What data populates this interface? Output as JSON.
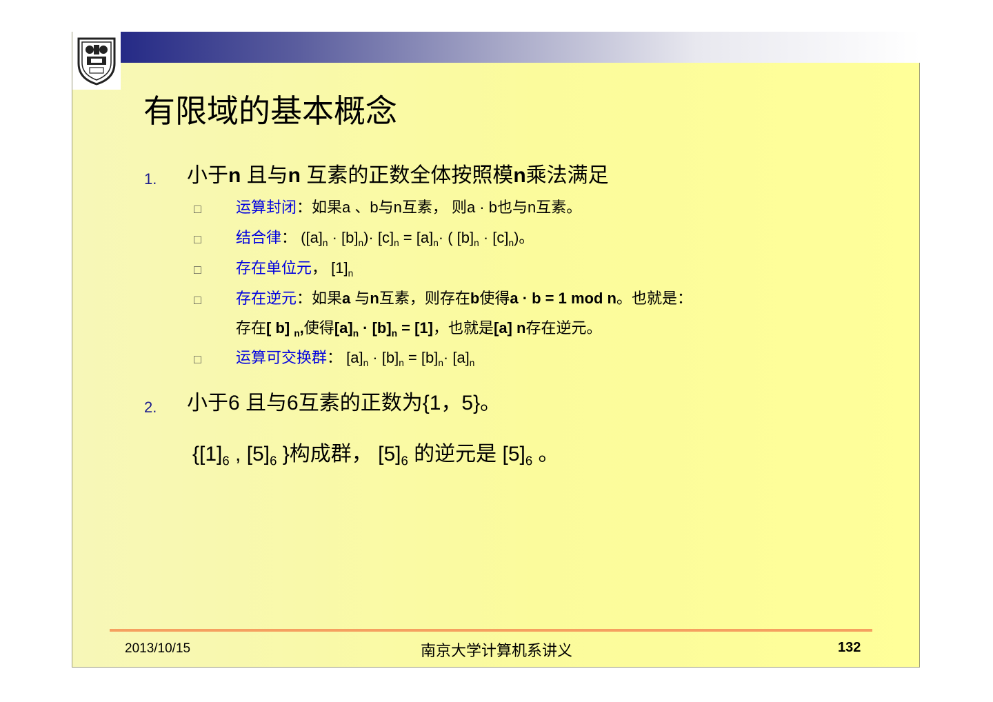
{
  "title": "有限域的基本概念",
  "item1": {
    "number": "1.",
    "a": "小于",
    "b": "n",
    "c": " 且与",
    "d": "n",
    "e": " 互素的正数全体按照模",
    "f": "n",
    "g": "乘法满足"
  },
  "sub": {
    "bullet": "□",
    "s1": {
      "label": "运算封闭",
      "text": "：如果a 、b与n互素， 则a · b也与n互素。"
    },
    "s2": {
      "label": "结合律",
      "t1": "：  ([a]",
      "n": "n",
      "t2": " · [b]",
      "t3": ")· [c]",
      "t4": " =  [a]",
      "t5": "· ( [b]",
      "t6": " · [c]",
      "t7": ")。"
    },
    "s3": {
      "label": "存在单位元",
      "t1": "，  [1]",
      "n": "n"
    },
    "s4": {
      "label": "存在逆元",
      "t1": "：如果",
      "t2": "a",
      "t3": " 与",
      "t4": "n",
      "t5": "互素，则存在",
      "t6": "b",
      "t7": "使得",
      "t8": "a · b = 1 mod n",
      "t9": "。也就是："
    },
    "s4b": {
      "t1": "存在",
      "t2": "[ b] ",
      "n": "n",
      "t3": ",",
      "t4": "使得",
      "t5": "[a]",
      "t6": " · [b]",
      "t7": " = [1]",
      "t8": "，也就是",
      "t9": "[a] n",
      "t10": "存在逆元。"
    },
    "s5": {
      "label": "运算可交换群",
      "t1": "：  [a]",
      "n": "n",
      "t2": " · [b]",
      "t3": " =  [b]",
      "t4": "· [a]"
    }
  },
  "item2": {
    "number": "2.",
    "line1": "小于6 且与6互素的正数为{1，5}。",
    "l2a": "{[1]",
    "six": "6",
    "l2b": " , [5]",
    "l2c": " }构成群，   [5]",
    "l2d": " 的逆元是 [5]",
    "l2e": " 。"
  },
  "footer": {
    "date": "2013/10/15",
    "center": "南京大学计算机系讲义",
    "page": "132"
  },
  "colors": {
    "banner_start": "#252a86",
    "slide_bg": "#ffff99",
    "accent_blue": "#0000e0",
    "footer_line": "#f5a060"
  }
}
